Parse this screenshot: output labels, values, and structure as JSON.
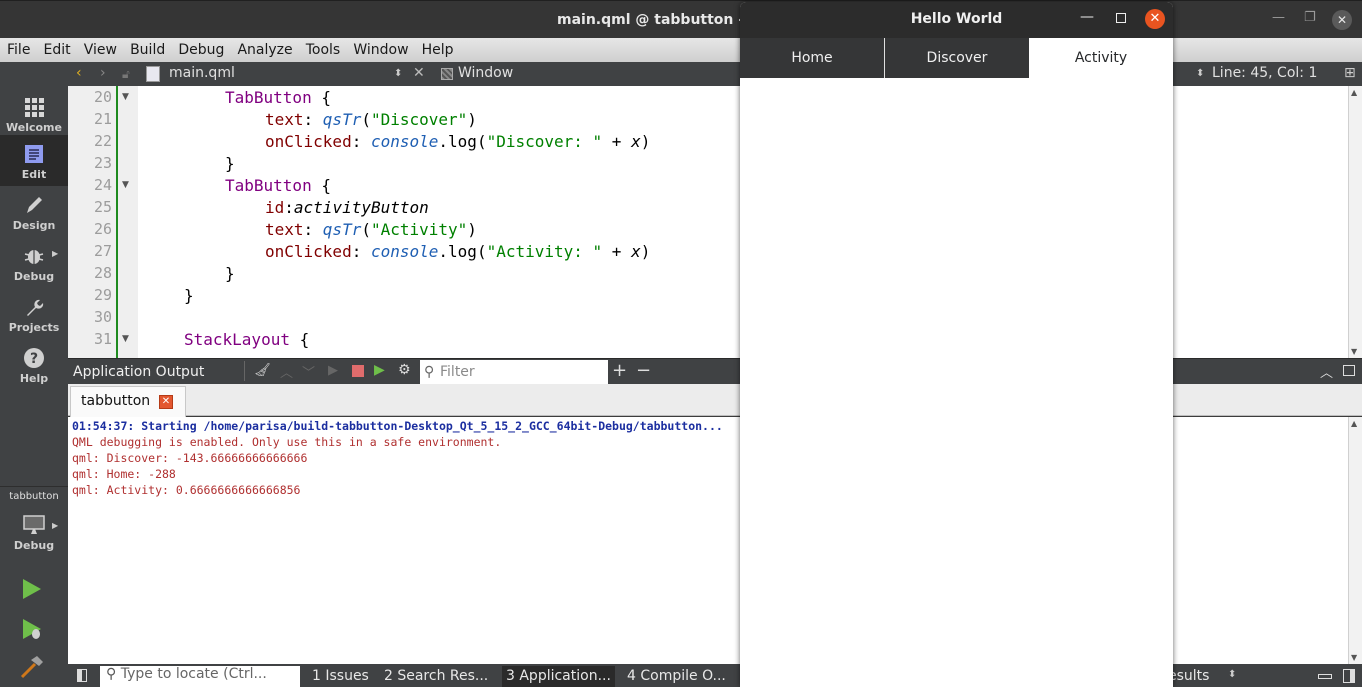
{
  "ide": {
    "window_title": "main.qml @ tabbutton - Qt Creator",
    "visible_title": "main.qml @ tabbutton - Q",
    "menu": [
      "File",
      "Edit",
      "View",
      "Build",
      "Debug",
      "Analyze",
      "Tools",
      "Window",
      "Help"
    ],
    "editor_toolbar": {
      "file_name": "main.qml",
      "symbol": "Window",
      "cursor_position": "Line: 45, Col: 1"
    },
    "modes": [
      {
        "label": "Welcome",
        "icon": "grid-icon"
      },
      {
        "label": "Edit",
        "icon": "edit-document-icon",
        "active": true
      },
      {
        "label": "Design",
        "icon": "pencil-icon"
      },
      {
        "label": "Debug",
        "icon": "bug-icon"
      },
      {
        "label": "Projects",
        "icon": "wrench-icon"
      },
      {
        "label": "Help",
        "icon": "help-icon"
      }
    ],
    "kit": {
      "project": "tabbutton",
      "build_config": "Debug"
    },
    "code_lines": [
      {
        "n": "20",
        "fold": true
      },
      {
        "n": "21"
      },
      {
        "n": "22"
      },
      {
        "n": "23"
      },
      {
        "n": "24",
        "fold": true
      },
      {
        "n": "25"
      },
      {
        "n": "26"
      },
      {
        "n": "27"
      },
      {
        "n": "28"
      },
      {
        "n": "29"
      },
      {
        "n": "30"
      },
      {
        "n": "31",
        "fold": true
      }
    ],
    "code": {
      "l20": "TabButton",
      "l21_prop": "text",
      "l21_fn": "qsTr",
      "l21_str": "\"Discover\"",
      "l22_prop": "onClicked",
      "l22_fn": "console",
      "l22_method": ".log(",
      "l22_str": "\"Discover: \"",
      "l22_rest": " + ",
      "l22_var": "x",
      "l24": "TabButton",
      "l25_prop": "id",
      "l25_val": "activityButton",
      "l26_prop": "text",
      "l26_fn": "qsTr",
      "l26_str": "\"Activity\"",
      "l27_prop": "onClicked",
      "l27_fn": "console",
      "l27_method": ".log(",
      "l27_str": "\"Activity: \"",
      "l27_rest": " + ",
      "l27_var": "x",
      "l31": "StackLayout"
    },
    "output_pane": {
      "title": "Application Output",
      "filter_placeholder": "Filter",
      "tab_label": "tabbutton",
      "lines": [
        {
          "text": "01:54:37: Starting /home/parisa/build-tabbutton-Desktop_Qt_5_15_2_GCC_64bit-Debug/tabbutton...",
          "kind": "info"
        },
        {
          "text": "QML debugging is enabled. Only use this in a safe environment.",
          "kind": "log"
        },
        {
          "text": "qml: Discover: -143.66666666666666",
          "kind": "log"
        },
        {
          "text": "qml: Home: -288",
          "kind": "log"
        },
        {
          "text": "qml: Activity: 0.6666666666666856",
          "kind": "log"
        }
      ]
    },
    "statusbar": {
      "locate_placeholder": "Type to locate (Ctrl...",
      "tabs": [
        "1 Issues",
        "2 Search Res...",
        "3 Application...",
        "4 Compile O..."
      ],
      "active_tab": "3 Application...",
      "right_text": "esults"
    }
  },
  "app": {
    "title": "Hello World",
    "tabs": [
      {
        "label": "Home",
        "checked": false
      },
      {
        "label": "Discover",
        "checked": false
      },
      {
        "label": "Activity",
        "checked": true
      }
    ]
  },
  "colors": {
    "ide_dark": "#404244",
    "app_tabbar": "#353637",
    "close_orange": "#e95420",
    "keyword": "#800080",
    "string": "#008000",
    "output_red": "#b03030",
    "output_blue": "#1c2fa0"
  }
}
